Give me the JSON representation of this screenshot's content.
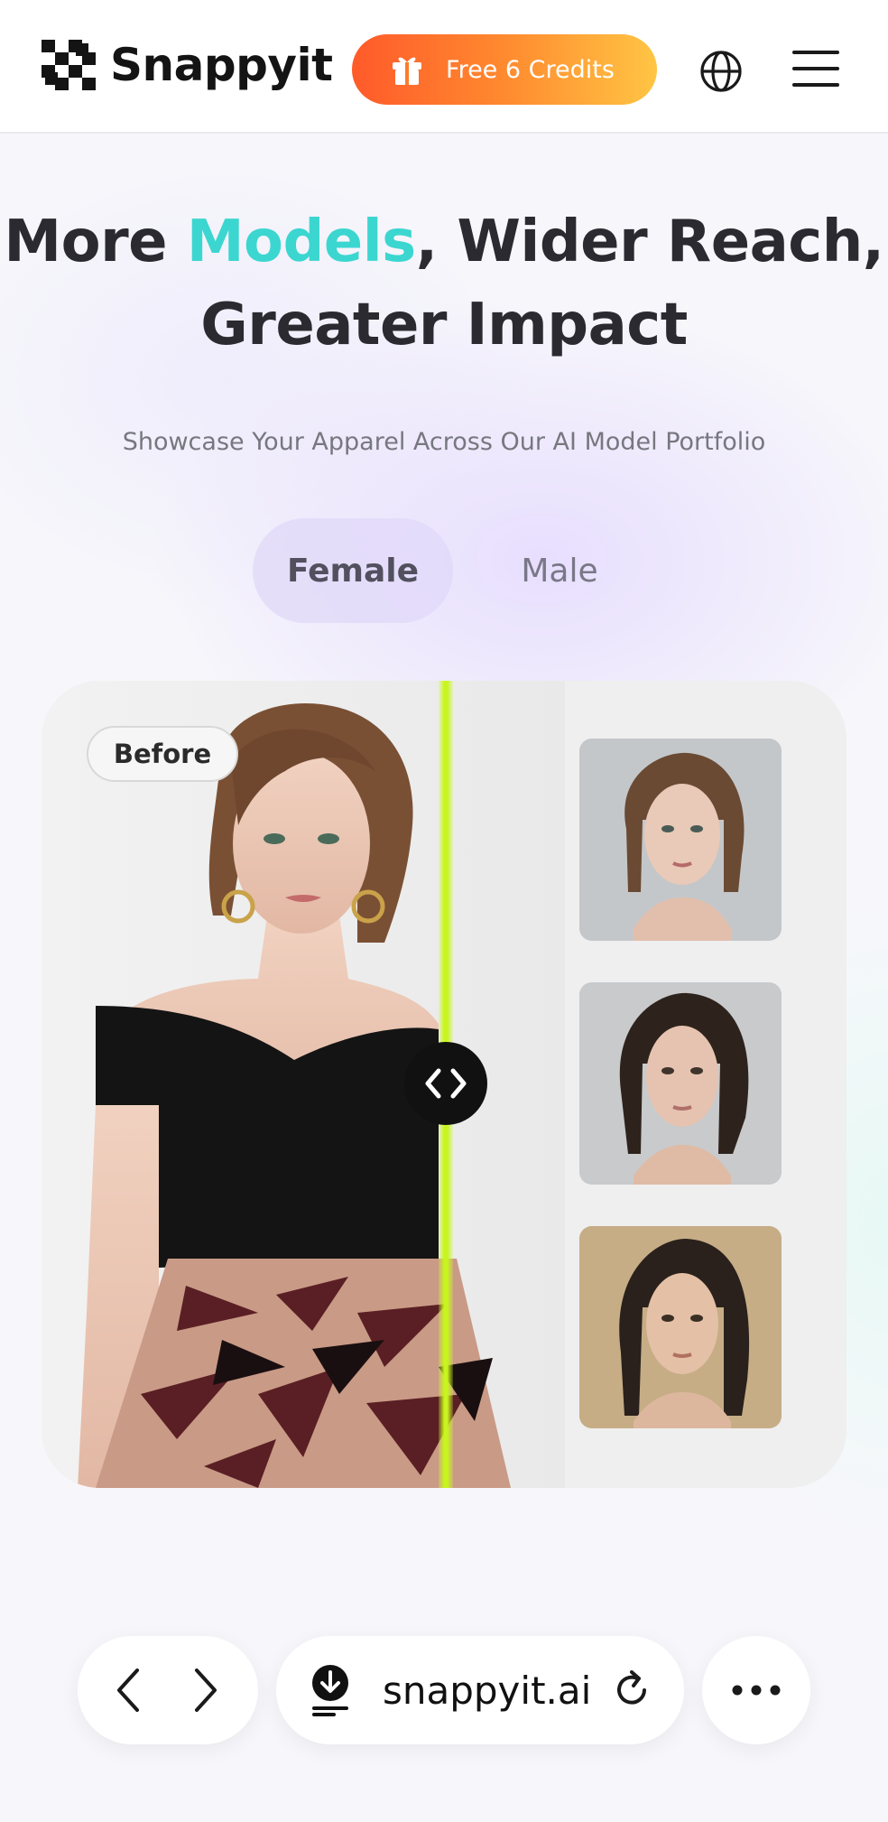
{
  "header": {
    "brand": "Snappyit",
    "credits_label": "Free 6 Credits"
  },
  "hero": {
    "title_part1": "More ",
    "title_accent": "Models",
    "title_part2": ", Wider Reach,",
    "title_line2": "Greater Impact",
    "subtitle": "Showcase Your Apparel Across Our AI Model Portfolio"
  },
  "tabs": [
    {
      "label": "Female",
      "active": true
    },
    {
      "label": "Male",
      "active": false
    }
  ],
  "comparison": {
    "before_label": "Before"
  },
  "browser_bar": {
    "url": "snappyit.ai"
  },
  "colors": {
    "accent": "#3cd6d0",
    "credits_gradient_start": "#ff5a2a",
    "credits_gradient_end": "#ffc544",
    "divider": "#c8f51e"
  },
  "icons": {
    "logo": "checker-logo-icon",
    "credits": "gift-icon",
    "language": "globe-icon",
    "menu": "hamburger-icon",
    "slider": "code-arrows-icon",
    "back": "chevron-left-icon",
    "forward": "chevron-right-icon",
    "download": "download-icon",
    "reload": "reload-icon",
    "more": "more-dots-icon"
  }
}
